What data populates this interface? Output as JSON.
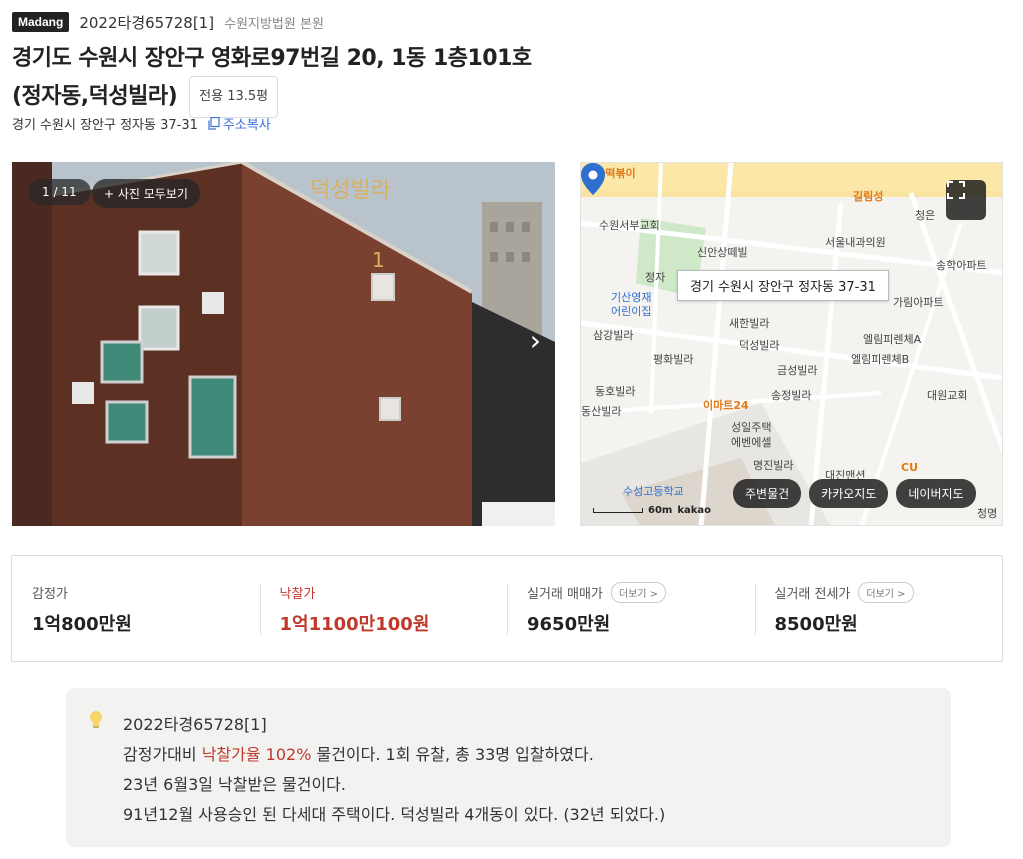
{
  "header": {
    "brand_badge": "Madang",
    "case_number": "2022타경65728[1]",
    "court": "수원지방법원 본원",
    "title_line1": "경기도 수원시 장안구 영화로97번길 20, 1동 1층101호",
    "title_line2": "(정자동,덕성빌라)",
    "area_tag": "전용 13.5평",
    "jibun_address": "경기 수원시 장안구 정자동 37-31",
    "copy_address_label": "주소복사"
  },
  "photo": {
    "counter": "1 / 11",
    "view_all_label": "+ 사진 모두보기",
    "next_glyph": "›",
    "sign_text": "덕성빌라",
    "sign_number": "1"
  },
  "map": {
    "callout": "경기 수원시 장안구 정자동 37-31",
    "labels": {
      "tteokbokki": "텔라떡볶이",
      "gilrimseong": "길림성",
      "cheongeun": "청은",
      "church": "수원서부교회",
      "sinan": "신안상떼빌",
      "seoul_clinic": "서울내과의원",
      "songhak": "송학아파트",
      "jeongja": "정자",
      "kisan1": "기산영재",
      "kisan2": "어린이집",
      "garim": "가림아파트",
      "saehan": "새한빌라",
      "samgang": "삼강빌라",
      "deokseong": "덕성빌라",
      "ellim_a": "엘림피렌체A",
      "ellim_b": "엘림피렌체B",
      "pyeonghwa": "평화빌라",
      "geumseong": "금성빌라",
      "songjeong": "송정빌라",
      "daewon": "대원교회",
      "dongho": "동호빌라",
      "dongsan": "동산빌라",
      "emart": "이마트24",
      "seongil1": "성일주택",
      "seongil2": "에벤에셀",
      "myeongjin": "명진빌라",
      "daejin": "대진맨션",
      "cu": "CU",
      "suseong": "수성고등학교",
      "cheongmyeong": "청명"
    },
    "scale_label": "60m",
    "provider": "kakao",
    "buttons": [
      "주변물건",
      "카카오지도",
      "네이버지도"
    ]
  },
  "prices": {
    "appraisal_label": "감정가",
    "appraisal_value": "1억800만원",
    "winning_label": "낙찰가",
    "winning_value": "1억1100만100원",
    "sale_label": "실거래 매매가",
    "sale_value": "9650만원",
    "jeonse_label": "실거래 전세가",
    "jeonse_value": "8500만원",
    "more_label": "더보기 >"
  },
  "summary": {
    "line1": "2022타경65728[1]",
    "line2_pre": "감정가대비 ",
    "line2_hl": "낙찰가율 102%",
    "line2_post": " 물건이다. 1회 유찰, 총 33명 입찰하였다.",
    "line3": "23년 6월3일 낙찰받은 물건이다.",
    "line4": "91년12월 사용승인 된 다세대 주택이다. 덕성빌라 4개동이 있다. (32년 되었다.)"
  },
  "colors": {
    "accent_red": "#c0392b",
    "link_blue": "#3b6fd9",
    "map_pin_blue": "#2f6fd0"
  }
}
